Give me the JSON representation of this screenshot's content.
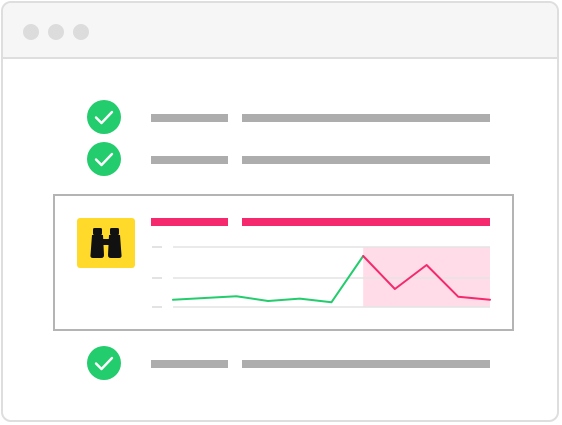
{
  "colors": {
    "success": "#23cc6c",
    "alert": "#f4296e",
    "alert_region": "#ffdce8",
    "placeholder_bar": "#adadad",
    "gridline": "#e3e3e3",
    "warning_badge": "#ffda2a",
    "baseline_line": "#23cc6c"
  },
  "window": {
    "controls": [
      "close-dot",
      "minimize-dot",
      "maximize-dot"
    ]
  },
  "checks": [
    {
      "status": "ok",
      "icon": "check-circle-icon"
    },
    {
      "status": "ok",
      "icon": "check-circle-icon"
    },
    {
      "status": "ok",
      "icon": "check-circle-icon"
    }
  ],
  "alert": {
    "status": "anomaly",
    "icon": "binoculars-icon",
    "chart_data": {
      "type": "line",
      "x": [
        0,
        1,
        2,
        3,
        4,
        5,
        6,
        7,
        8,
        9,
        10
      ],
      "series": [
        {
          "values": [
            1.2,
            1.5,
            1.8,
            1.0,
            1.4,
            0.8,
            8.5,
            3.0,
            7.0,
            1.7,
            1.2
          ]
        }
      ],
      "anomaly_range": [
        6,
        10
      ],
      "ylim": [
        0,
        10
      ],
      "grid": true
    }
  }
}
